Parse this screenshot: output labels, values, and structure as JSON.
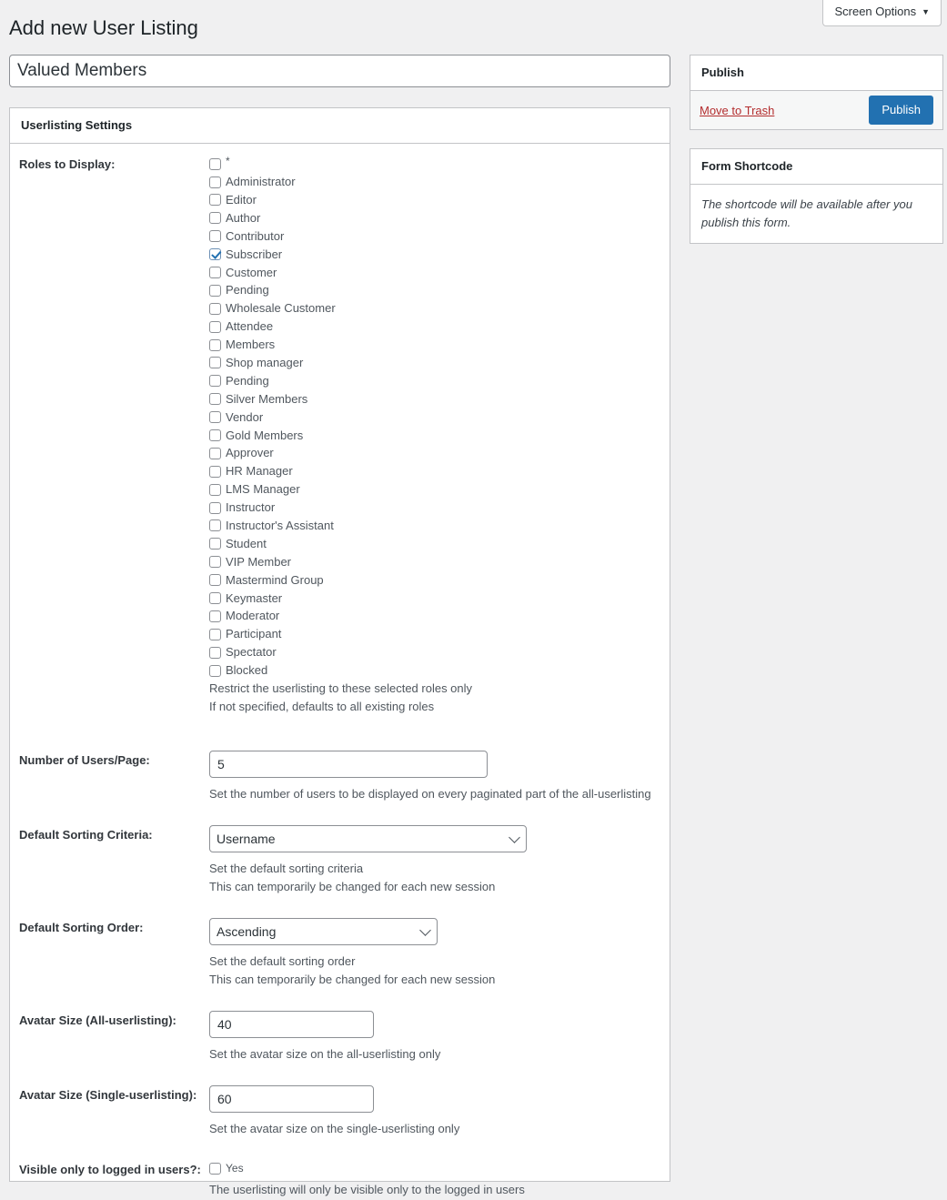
{
  "screen_options": {
    "label": "Screen Options",
    "caret": "chevron-down-icon"
  },
  "page": {
    "title": "Add new User Listing"
  },
  "title_field": {
    "value": "Valued Members",
    "placeholder": "Add title"
  },
  "settings_panel": {
    "heading": "Userlisting Settings",
    "roles": {
      "label": "Roles to Display:",
      "items": [
        {
          "label": "*",
          "checked": false
        },
        {
          "label": "Administrator",
          "checked": false
        },
        {
          "label": "Editor",
          "checked": false
        },
        {
          "label": "Author",
          "checked": false
        },
        {
          "label": "Contributor",
          "checked": false
        },
        {
          "label": "Subscriber",
          "checked": true
        },
        {
          "label": "Customer",
          "checked": false
        },
        {
          "label": "Pending",
          "checked": false
        },
        {
          "label": "Wholesale Customer",
          "checked": false
        },
        {
          "label": "Attendee",
          "checked": false
        },
        {
          "label": "Members",
          "checked": false
        },
        {
          "label": "Shop manager",
          "checked": false
        },
        {
          "label": "Pending",
          "checked": false
        },
        {
          "label": "Silver Members",
          "checked": false
        },
        {
          "label": "Vendor",
          "checked": false
        },
        {
          "label": "Gold Members",
          "checked": false
        },
        {
          "label": "Approver",
          "checked": false
        },
        {
          "label": "HR Manager",
          "checked": false
        },
        {
          "label": "LMS Manager",
          "checked": false
        },
        {
          "label": "Instructor",
          "checked": false
        },
        {
          "label": "Instructor's Assistant",
          "checked": false
        },
        {
          "label": "Student",
          "checked": false
        },
        {
          "label": "VIP Member",
          "checked": false
        },
        {
          "label": "Mastermind Group",
          "checked": false
        },
        {
          "label": "Keymaster",
          "checked": false
        },
        {
          "label": "Moderator",
          "checked": false
        },
        {
          "label": "Participant",
          "checked": false
        },
        {
          "label": "Spectator",
          "checked": false
        },
        {
          "label": "Blocked",
          "checked": false
        }
      ],
      "desc_line1": "Restrict the userlisting to these selected roles only",
      "desc_line2": "If not specified, defaults to all existing roles"
    },
    "users_per_page": {
      "label": "Number of Users/Page:",
      "value": "5",
      "desc": "Set the number of users to be displayed on every paginated part of the all-userlisting"
    },
    "sorting_criteria": {
      "label": "Default Sorting Criteria:",
      "value": "Username",
      "options": [
        "Username"
      ],
      "desc_line1": "Set the default sorting criteria",
      "desc_line2": "This can temporarily be changed for each new session"
    },
    "sorting_order": {
      "label": "Default Sorting Order:",
      "value": "Ascending",
      "options": [
        "Ascending"
      ],
      "desc_line1": "Set the default sorting order",
      "desc_line2": "This can temporarily be changed for each new session"
    },
    "avatar_all": {
      "label": "Avatar Size (All-userlisting):",
      "value": "40",
      "desc": "Set the avatar size on the all-userlisting only"
    },
    "avatar_single": {
      "label": "Avatar Size (Single-userlisting):",
      "value": "60",
      "desc": "Set the avatar size on the single-userlisting only"
    },
    "logged_in_only": {
      "label": "Visible only to logged in users?:",
      "checkbox_label": "Yes",
      "checked": false,
      "desc": "The userlisting will only be visible only to the logged in users"
    }
  },
  "publish_box": {
    "heading": "Publish",
    "trash_label": "Move to Trash",
    "publish_label": "Publish"
  },
  "shortcode_box": {
    "heading": "Form Shortcode",
    "note": "The shortcode will be available after you publish this form."
  },
  "colors": {
    "accent": "#2271b1",
    "trash": "#b32d2e",
    "page_bg": "#f0f0f1",
    "border": "#c3c4c7"
  }
}
